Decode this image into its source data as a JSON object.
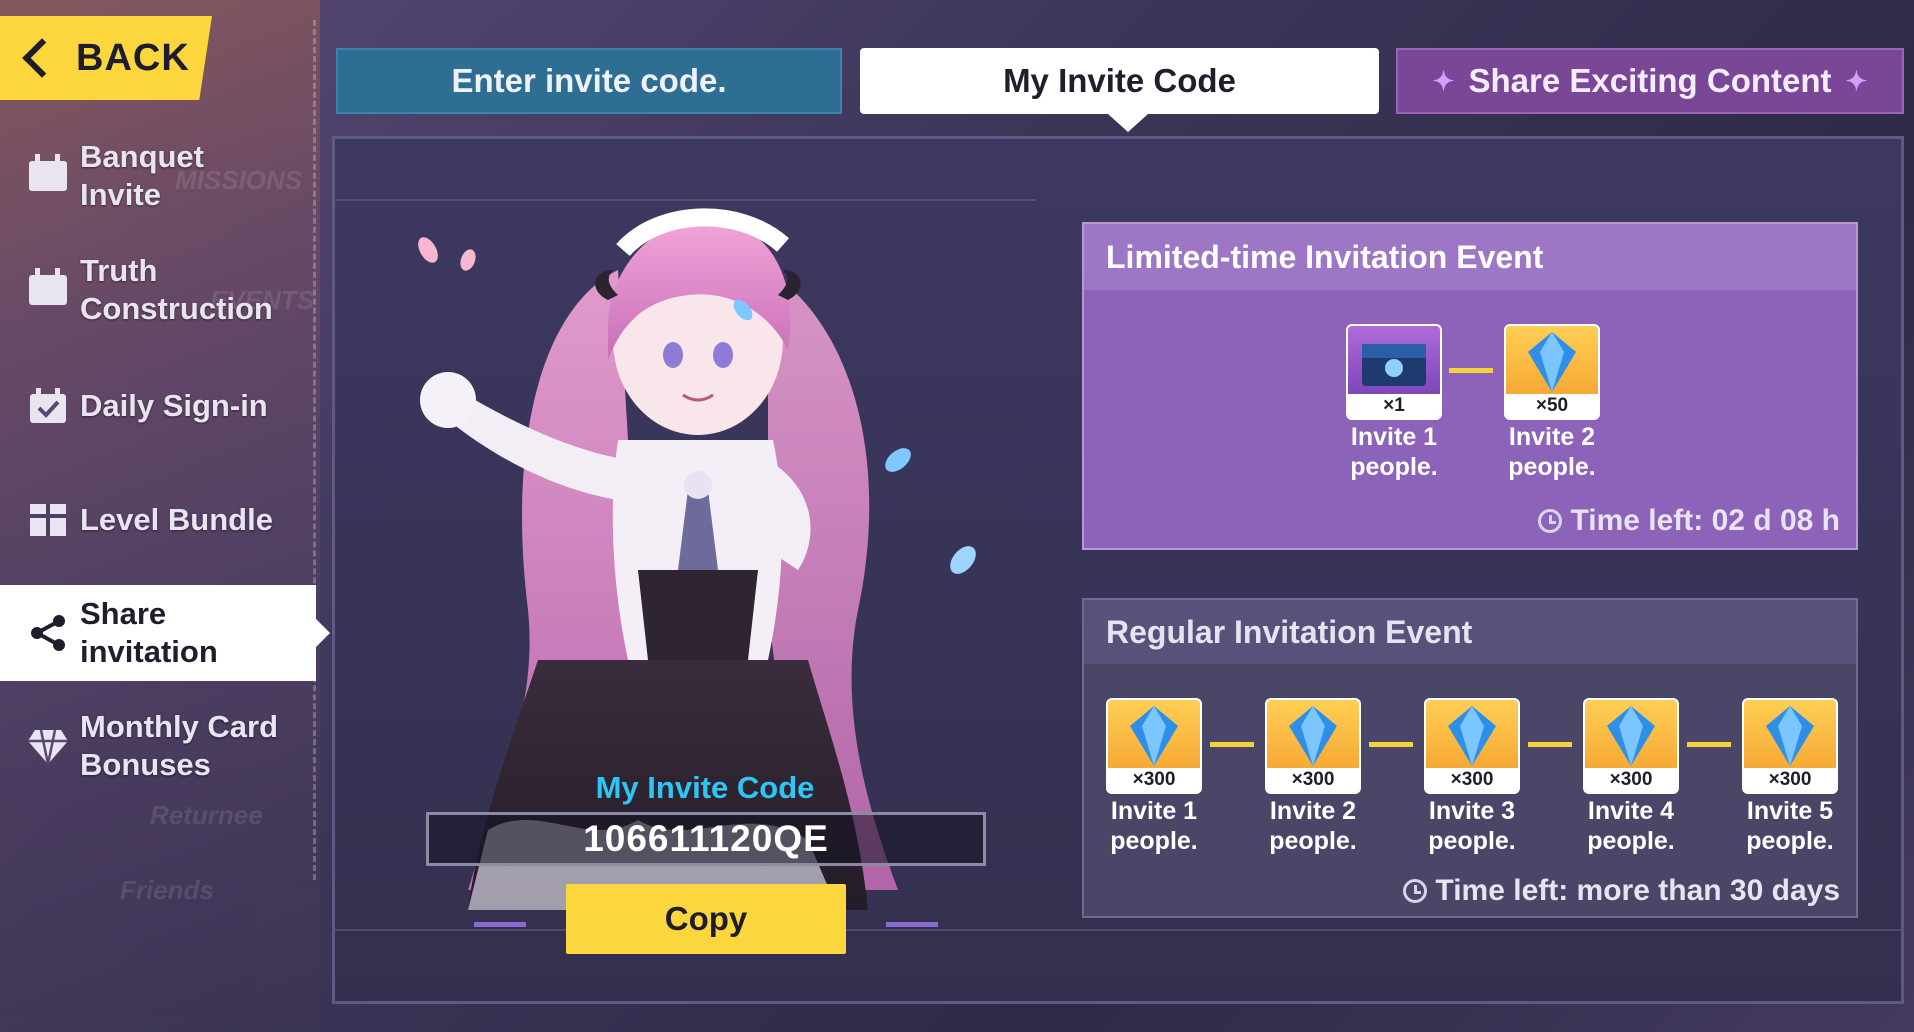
{
  "colors": {
    "accent_yellow": "#fbd63c",
    "tab_enter": "#2e6e93",
    "tab_share": "#7a4796",
    "invite_code_title": "#2fc6f5"
  },
  "nav": {
    "back_label": "BACK"
  },
  "sidebar": {
    "items": [
      {
        "label_line1": "Banquet",
        "label_line2": "Invite",
        "icon": "calendar-icon"
      },
      {
        "label_line1": "Truth",
        "label_line2": "Construction",
        "icon": "calendar-icon"
      },
      {
        "label_line1": "Daily Sign-in",
        "label_line2": "",
        "icon": "calendar-check-icon"
      },
      {
        "label_line1": "Level Bundle",
        "label_line2": "",
        "icon": "gift-icon"
      },
      {
        "label_line1": "Share",
        "label_line2": "invitation",
        "icon": "share-icon",
        "active": true
      },
      {
        "label_line1": "Monthly Card",
        "label_line2": "Bonuses",
        "icon": "gem-icon"
      }
    ]
  },
  "tabs": {
    "enter_code": "Enter invite code.",
    "my_code": "My Invite Code",
    "share": "Share Exciting Content"
  },
  "invite": {
    "title": "My Invite Code",
    "code": "106611120QE",
    "copy_label": "Copy"
  },
  "limited_event": {
    "title": "Limited-time Invitation Event",
    "rewards": [
      {
        "qty": "×1",
        "line1": "Invite 1",
        "line2": "people.",
        "icon": "treasure-chest-icon"
      },
      {
        "qty": "×50",
        "line1": "Invite 2",
        "line2": "people.",
        "icon": "crystal-icon"
      }
    ],
    "time_left": "Time left: 02 d 08 h"
  },
  "regular_event": {
    "title": "Regular Invitation Event",
    "rewards": [
      {
        "qty": "×300",
        "line1": "Invite 1",
        "line2": "people.",
        "icon": "crystal-icon"
      },
      {
        "qty": "×300",
        "line1": "Invite 2",
        "line2": "people.",
        "icon": "crystal-icon"
      },
      {
        "qty": "×300",
        "line1": "Invite 3",
        "line2": "people.",
        "icon": "crystal-icon"
      },
      {
        "qty": "×300",
        "line1": "Invite 4",
        "line2": "people.",
        "icon": "crystal-icon"
      },
      {
        "qty": "×300",
        "line1": "Invite 5",
        "line2": "people.",
        "icon": "crystal-icon"
      }
    ],
    "time_left": "Time left: more than 30 days"
  }
}
